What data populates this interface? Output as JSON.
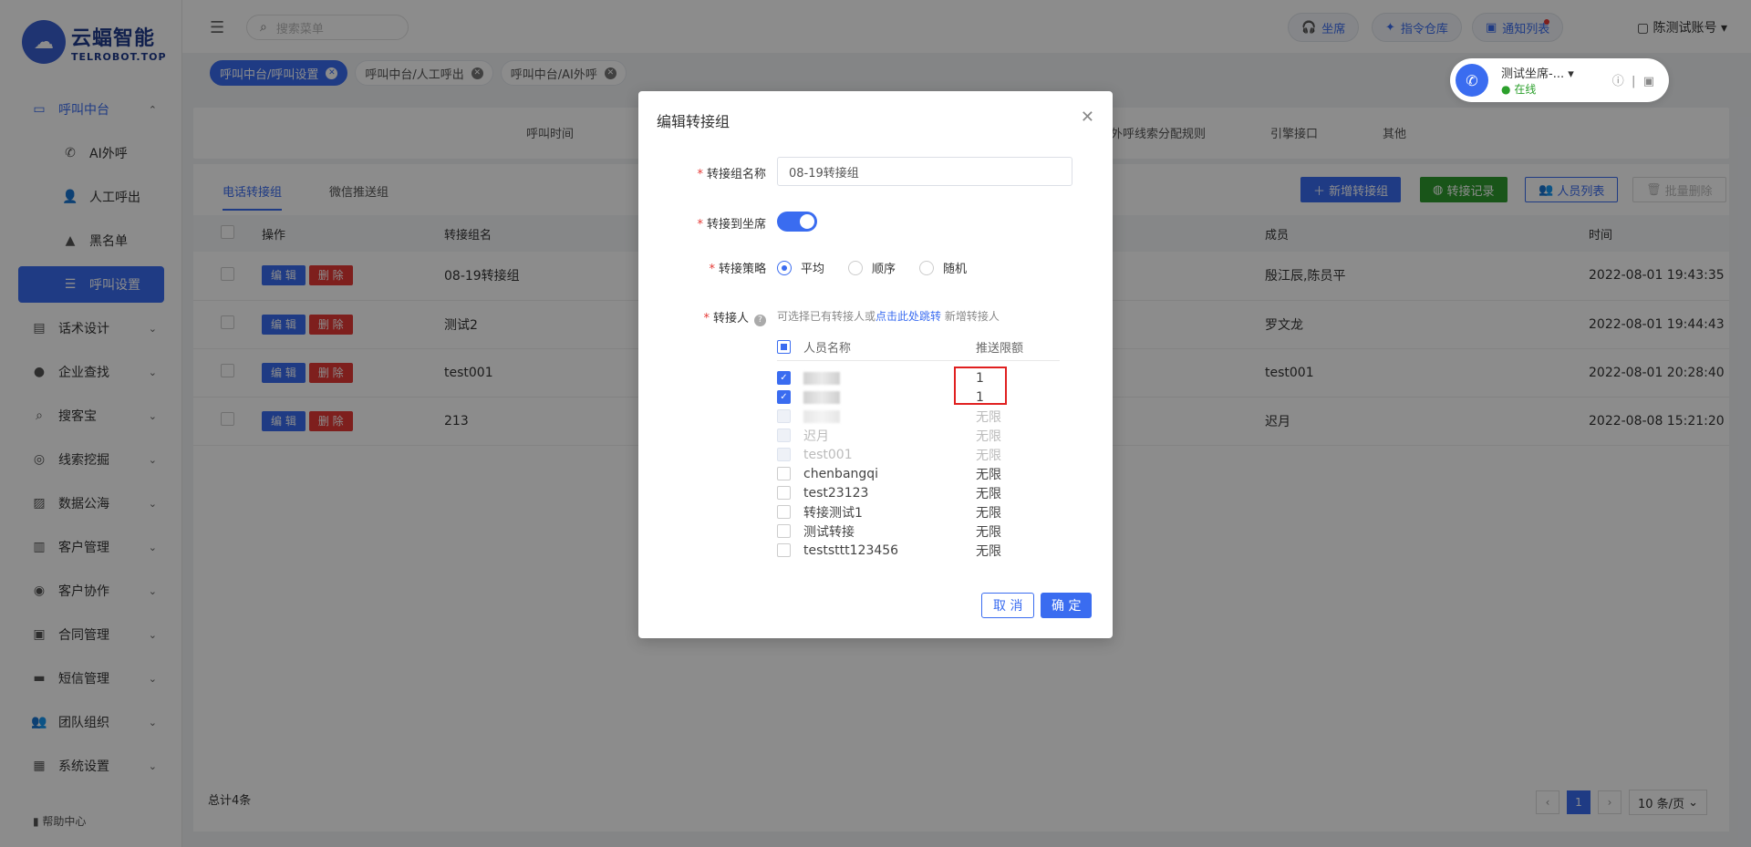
{
  "brand": {
    "name_cn": "云蝠智能",
    "name_en": "TELROBOT.TOP",
    "mark": "云"
  },
  "sidebar": {
    "items": [
      {
        "label": "呼叫中台",
        "icon": "monitor-icon",
        "open": true
      },
      {
        "label": "AI外呼",
        "icon": "phone-icon",
        "sub": true
      },
      {
        "label": "人工呼出",
        "icon": "user-icon",
        "sub": true
      },
      {
        "label": "黑名单",
        "icon": "warning-icon",
        "sub": true
      },
      {
        "label": "呼叫设置",
        "icon": "sliders-icon",
        "sub": true,
        "active": true
      },
      {
        "label": "话术设计",
        "icon": "book-icon"
      },
      {
        "label": "企业查找",
        "icon": "bulb-icon"
      },
      {
        "label": "搜客宝",
        "icon": "search-icon"
      },
      {
        "label": "线索挖掘",
        "icon": "target-icon"
      },
      {
        "label": "数据公海",
        "icon": "image-icon"
      },
      {
        "label": "客户管理",
        "icon": "contacts-icon"
      },
      {
        "label": "客户协作",
        "icon": "team-icon"
      },
      {
        "label": "合同管理",
        "icon": "file-icon"
      },
      {
        "label": "短信管理",
        "icon": "message-icon"
      },
      {
        "label": "团队组织",
        "icon": "group-icon"
      },
      {
        "label": "系统设置",
        "icon": "grid-icon"
      }
    ],
    "help": "帮助中心"
  },
  "topbar": {
    "search_placeholder": "搜索菜单",
    "seat_btn": "坐席",
    "cmd_btn": "指令仓库",
    "notice_btn": "通知列表",
    "user": "陈测试账号"
  },
  "tags": [
    {
      "label": "呼叫中台/呼叫设置",
      "active": true
    },
    {
      "label": "呼叫中台/人工呼出",
      "active": false
    },
    {
      "label": "呼叫中台/AI外呼",
      "active": false
    }
  ],
  "phone": {
    "name": "测试坐席-...",
    "status": "在线"
  },
  "categories": [
    "呼叫时间",
    "外呼线索分配规则",
    "引擎接口",
    "其他"
  ],
  "subtabs": [
    "电话转接组",
    "微信推送组"
  ],
  "actions": {
    "add": "新增转接组",
    "record": "转接记录",
    "people": "人员列表",
    "batch_delete": "批量删除"
  },
  "table": {
    "headers": {
      "op": "操作",
      "name": "转接组名",
      "members": "成员",
      "time": "时间"
    },
    "edit": "编 辑",
    "delete": "删 除",
    "rows": [
      {
        "name": "08-19转接组",
        "members": "殷江辰,陈员平",
        "time": "2022-08-01 19:43:35"
      },
      {
        "name": "测试2",
        "members": "罗文龙",
        "time": "2022-08-01 19:44:43"
      },
      {
        "name": "test001",
        "members": "test001",
        "time": "2022-08-01 20:28:40"
      },
      {
        "name": "213",
        "members": "迟月",
        "time": "2022-08-08 15:21:20"
      }
    ]
  },
  "footer": {
    "total": "总计4条",
    "page": "1",
    "page_size": "10 条/页"
  },
  "modal": {
    "title": "编辑转接组",
    "group_name_label": "转接组名称",
    "group_name_value": "08-19转接组",
    "to_seat_label": "转接到坐席",
    "strategy_label": "转接策略",
    "strategies": [
      "平均",
      "顺序",
      "随机"
    ],
    "transfer_label": "转接人",
    "hint_prefix": "可选择已有转接人或",
    "hint_link": "点击此处跳转",
    "hint_suffix": "新增转接人",
    "col_name": "人员名称",
    "col_limit": "推送限额",
    "persons": [
      {
        "name": "",
        "limit": "1",
        "state": "checked",
        "blurred": true
      },
      {
        "name": "",
        "limit": "1",
        "state": "checked",
        "blurred": true
      },
      {
        "name": "",
        "limit": "无限",
        "state": "disabled",
        "blurred": true
      },
      {
        "name": "迟月",
        "limit": "无限",
        "state": "disabled"
      },
      {
        "name": "test001",
        "limit": "无限",
        "state": "disabled"
      },
      {
        "name": "chenbangqi",
        "limit": "无限",
        "state": "unchecked"
      },
      {
        "name": "test23123",
        "limit": "无限",
        "state": "unchecked"
      },
      {
        "name": "转接测试1",
        "limit": "无限",
        "state": "unchecked"
      },
      {
        "name": "测试转接",
        "limit": "无限",
        "state": "unchecked"
      },
      {
        "name": "teststtt123456",
        "limit": "无限",
        "state": "unchecked"
      }
    ],
    "cancel": "取 消",
    "ok": "确 定"
  }
}
